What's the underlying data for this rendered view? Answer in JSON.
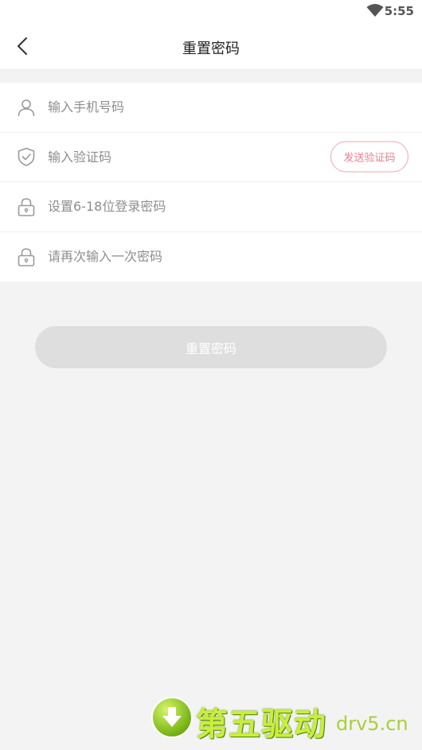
{
  "status_bar": {
    "time": "5:55",
    "wifi_icon": "wifi-icon"
  },
  "header": {
    "title": "重置密码",
    "back_icon": "chevron-left-icon"
  },
  "form": {
    "phone": {
      "icon": "user-icon",
      "placeholder": "输入手机号码"
    },
    "code": {
      "icon": "shield-check-icon",
      "placeholder": "输入验证码",
      "send_label": "发送验证码"
    },
    "password": {
      "icon": "lock-icon",
      "placeholder": "设置6-18位登录密码"
    },
    "confirm": {
      "icon": "lock-icon",
      "placeholder": "请再次输入一次密码"
    }
  },
  "submit": {
    "label": "重置密码"
  },
  "colors": {
    "accent": "#ec7f93",
    "disabled_button": "#dedede",
    "background": "#f3f3f3"
  },
  "watermark": {
    "brand": "第五驱动",
    "domain": "drv5.cn",
    "icon": "download-arrow-icon"
  }
}
